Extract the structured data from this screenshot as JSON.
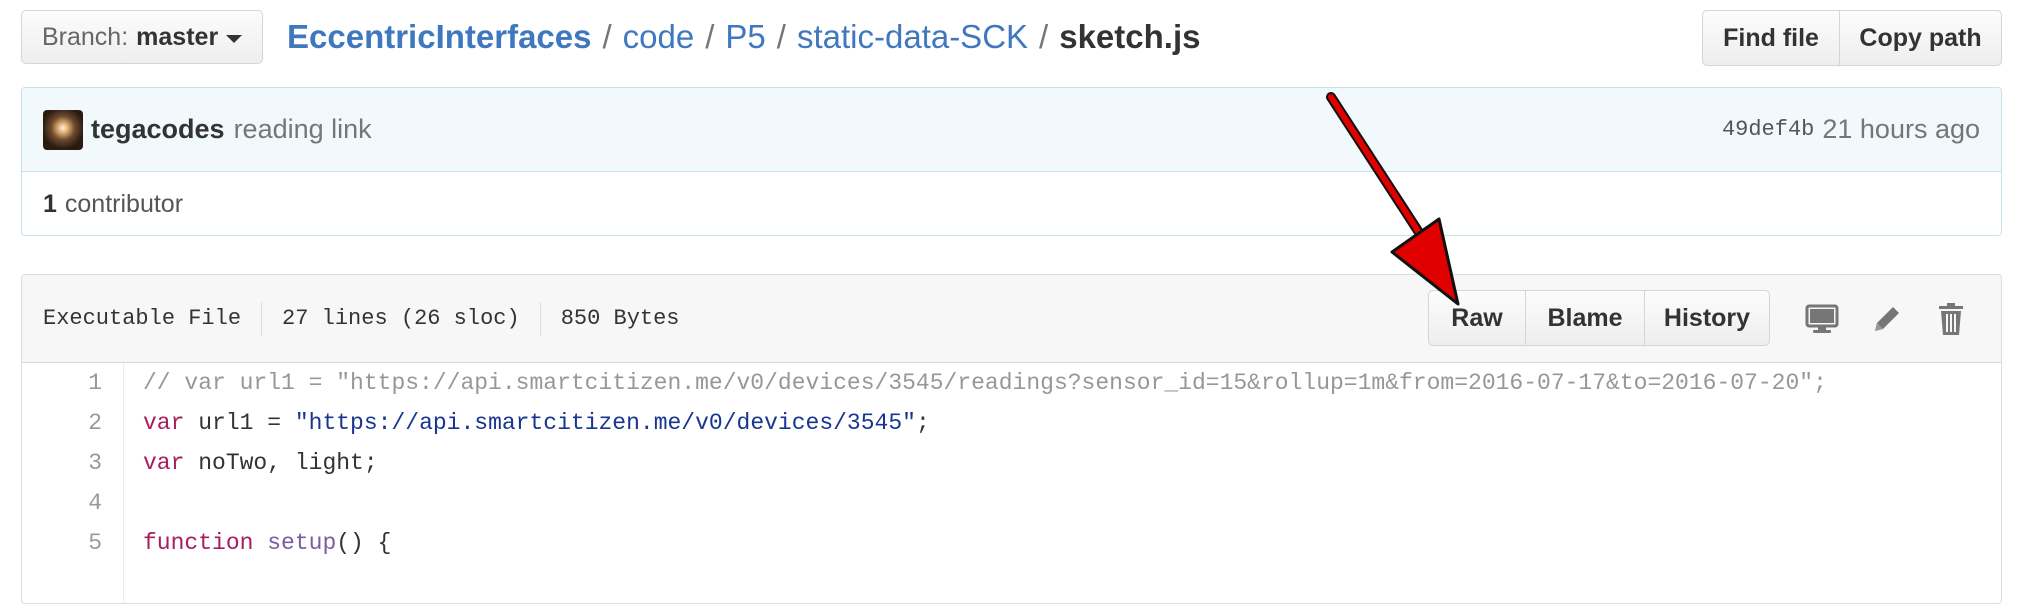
{
  "branch": {
    "label": "Branch:",
    "name": "master"
  },
  "breadcrumb": {
    "items": [
      "EccentricInterfaces",
      "code",
      "P5",
      "static-data-SCK"
    ],
    "separator": "/",
    "current": "sketch.js"
  },
  "header_actions": {
    "find_file": "Find file",
    "copy_path": "Copy path"
  },
  "commit": {
    "author": "tegacodes",
    "message": "reading link",
    "sha": "49def4b",
    "time": "21 hours ago"
  },
  "contributors": {
    "count": "1",
    "label": "contributor"
  },
  "file": {
    "mode": "Executable File",
    "lines": "27 lines (26 sloc)",
    "size": "850 Bytes",
    "actions": {
      "raw": "Raw",
      "blame": "Blame",
      "history": "History"
    },
    "icons": [
      "desktop-icon",
      "pencil-icon",
      "trash-icon"
    ]
  },
  "code": {
    "line_numbers": [
      "1",
      "2",
      "3",
      "4",
      "5"
    ],
    "line1_comment": "// var url1 = \"https://api.smartcitizen.me/v0/devices/3545/readings?sensor_id=15&rollup=1m&from=2016-07-17&to=2016-07-20\";",
    "line2_kw": "var",
    "line2_mid": " url1 = ",
    "line2_str": "\"https://api.smartcitizen.me/v0/devices/3545\"",
    "line2_end": ";",
    "line3_kw": "var",
    "line3_rest": " noTwo, light;",
    "line5_kw": "function",
    "line5_fn": "setup",
    "line5_rest": "() {"
  },
  "colors": {
    "link": "#4078c0",
    "commit_bg": "#f2f9fc",
    "keyword": "#a71d5d",
    "string": "#183691",
    "function": "#795da3",
    "comment": "#969896",
    "arrow": "#e00000"
  }
}
